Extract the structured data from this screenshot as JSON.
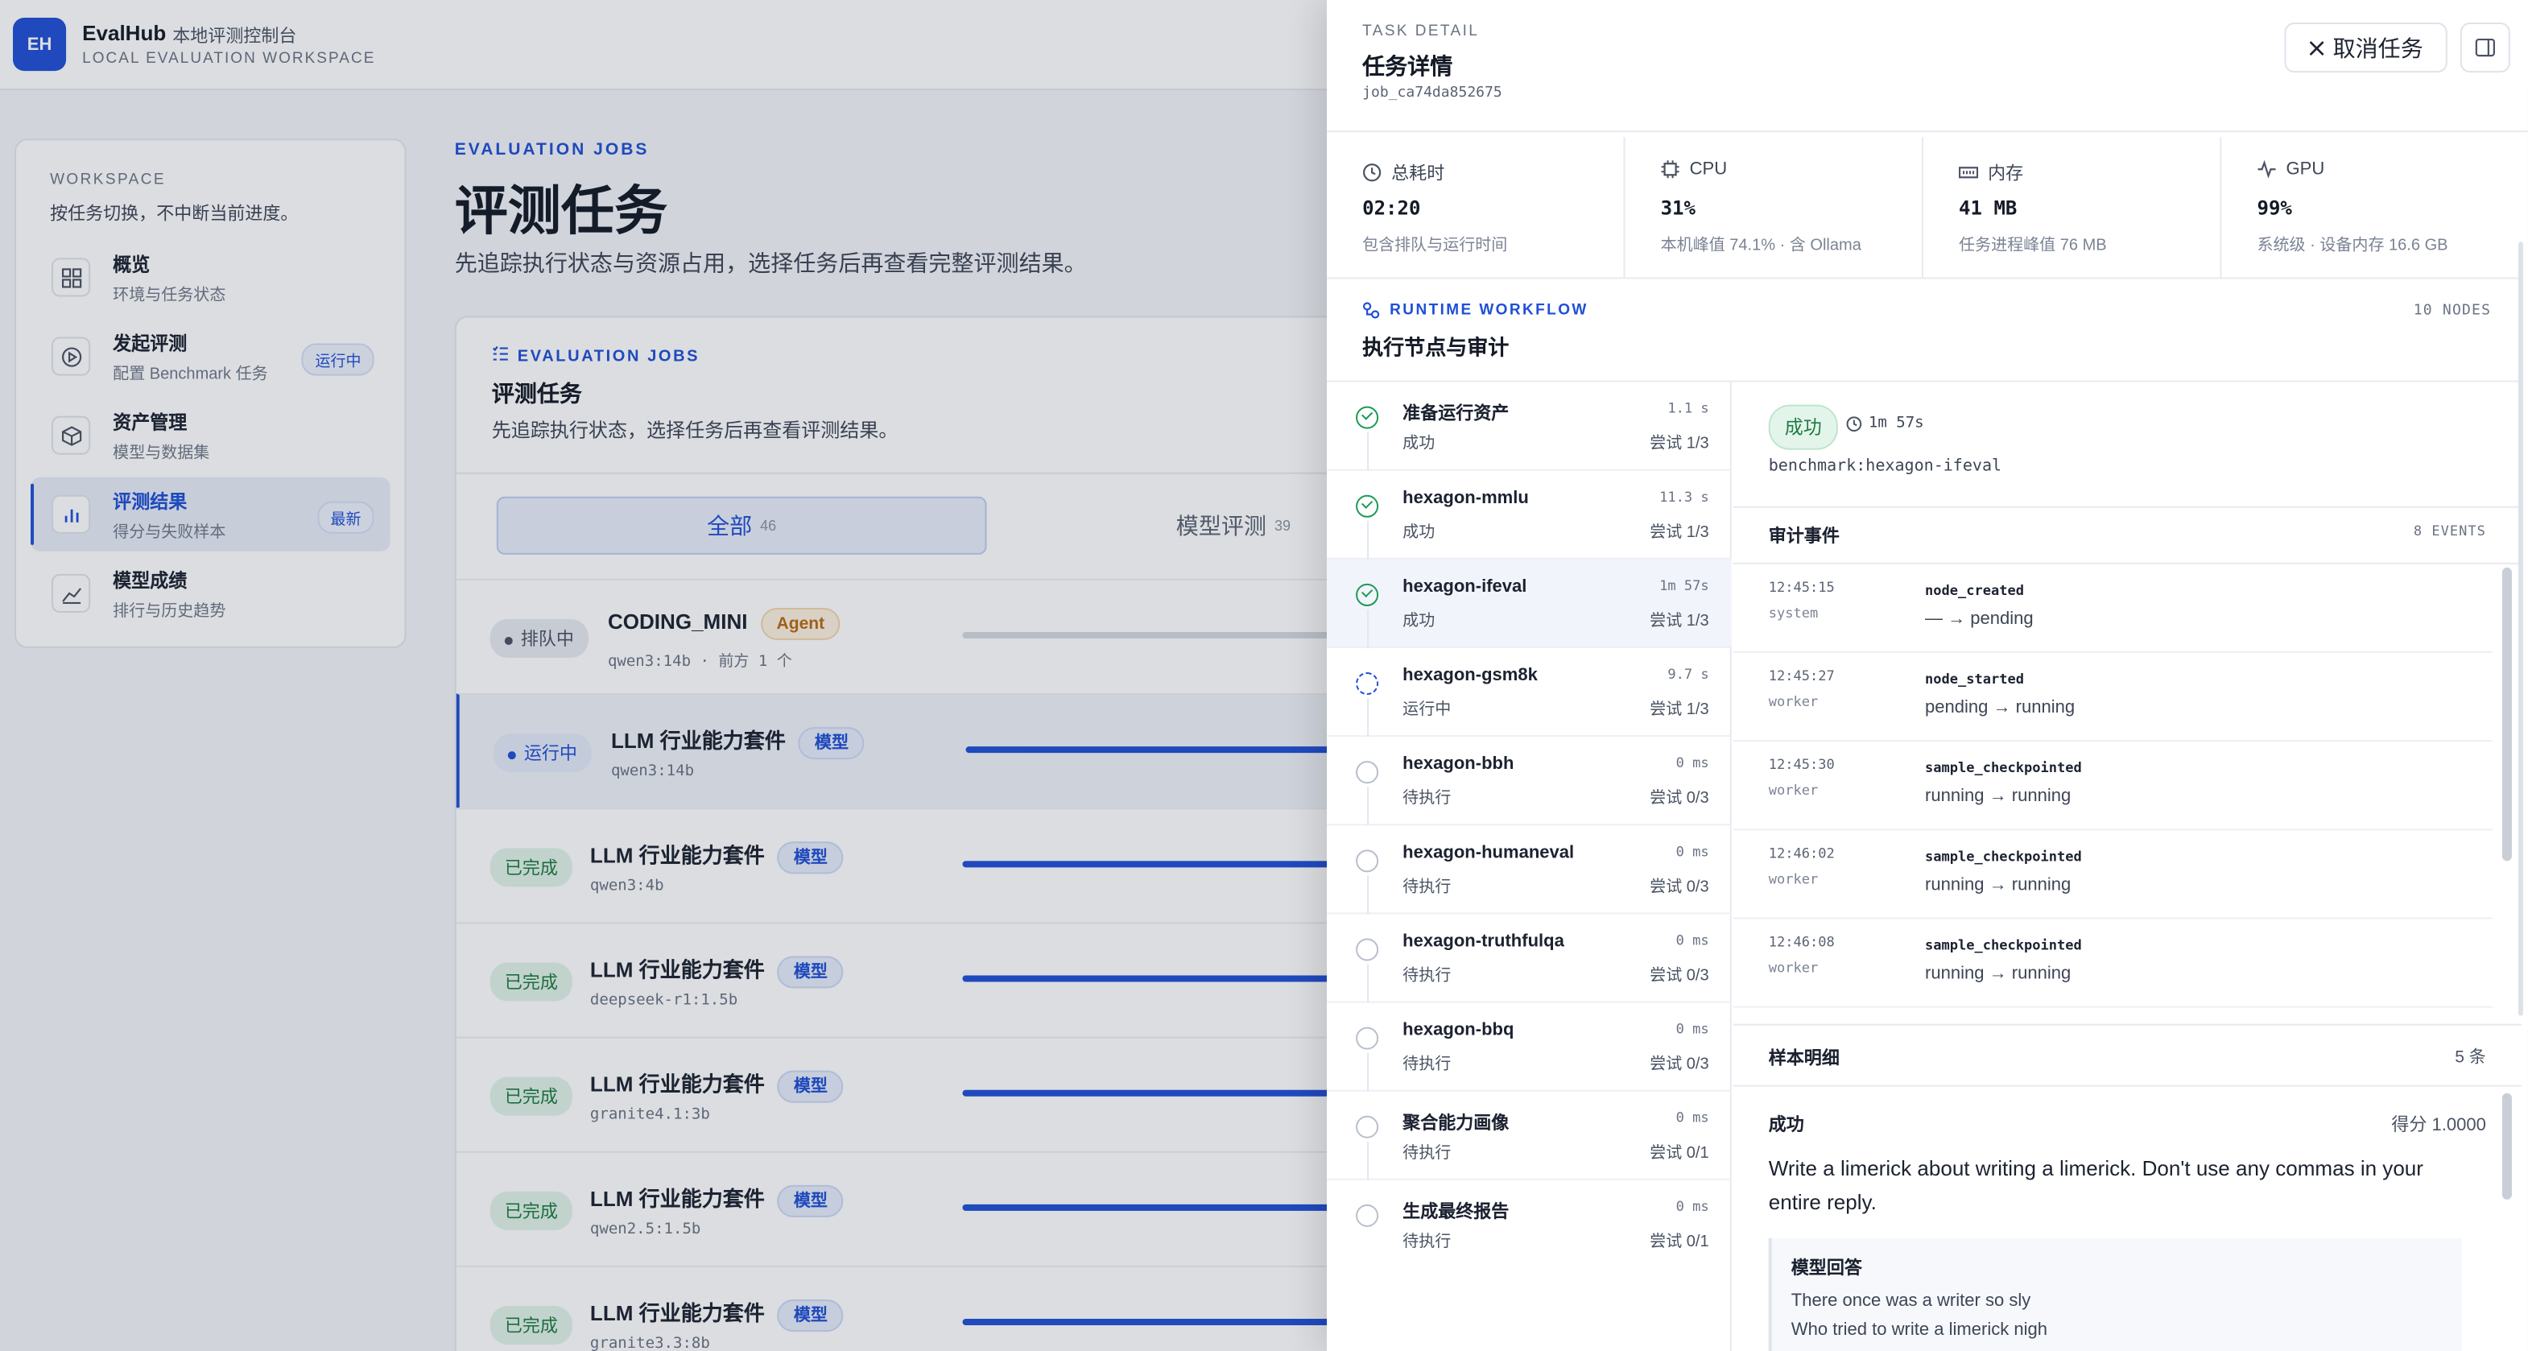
{
  "brand": {
    "logo": "EH",
    "name": "EvalHub",
    "subtitle": "本地评测控制台",
    "en": "LOCAL EVALUATION WORKSPACE"
  },
  "sidebar": {
    "label": "WORKSPACE",
    "desc": "按任务切换，不中断当前进度。",
    "items": [
      {
        "title": "概览",
        "sub": "环境与任务状态",
        "badge": "",
        "icon": "grid-icon"
      },
      {
        "title": "发起评测",
        "sub": "配置 Benchmark 任务",
        "badge": "运行中",
        "icon": "play-icon"
      },
      {
        "title": "资产管理",
        "sub": "模型与数据集",
        "badge": "",
        "icon": "box-icon"
      },
      {
        "title": "评测结果",
        "sub": "得分与失败样本",
        "badge": "最新",
        "icon": "bar-chart-icon"
      },
      {
        "title": "模型成绩",
        "sub": "排行与历史趋势",
        "badge": "",
        "icon": "trend-icon"
      }
    ]
  },
  "main": {
    "eyebrow": "EVALUATION JOBS",
    "title": "评测任务",
    "desc": "先追踪执行状态与资源占用，选择任务后再查看完整评测结果。"
  },
  "panel": {
    "eyebrow": "EVALUATION JOBS",
    "title": "评测任务",
    "desc": "先追踪执行状态，选择任务后再查看评测结果。",
    "tabs": [
      {
        "label": "全部",
        "count": "46"
      },
      {
        "label": "模型评测",
        "count": "39"
      }
    ],
    "jobs": [
      {
        "status": "排队中",
        "name": "CODING_MINI",
        "tag": "Agent",
        "sub": "qwen3:14b · 前方 1 个",
        "progress": 0.9
      },
      {
        "status": "运行中",
        "name": "LLM 行业能力套件",
        "tag": "模型",
        "sub": "qwen3:14b",
        "progress": 1.0
      },
      {
        "status": "已完成",
        "name": "LLM 行业能力套件",
        "tag": "模型",
        "sub": "qwen3:4b",
        "progress": 1.0
      },
      {
        "status": "已完成",
        "name": "LLM 行业能力套件",
        "tag": "模型",
        "sub": "deepseek-r1:1.5b",
        "progress": 1.0
      },
      {
        "status": "已完成",
        "name": "LLM 行业能力套件",
        "tag": "模型",
        "sub": "granite4.1:3b",
        "progress": 1.0
      },
      {
        "status": "已完成",
        "name": "LLM 行业能力套件",
        "tag": "模型",
        "sub": "qwen2.5:1.5b",
        "progress": 1.0
      },
      {
        "status": "已完成",
        "name": "LLM 行业能力套件",
        "tag": "模型",
        "sub": "granite3.3:8b",
        "progress": 1.0
      }
    ]
  },
  "drawer": {
    "eyebrow": "TASK DETAIL",
    "title": "任务详情",
    "job_id": "job_ca74da852675",
    "cancel_label": "取消任务",
    "metrics": [
      {
        "label": "总耗时",
        "value": "02:20",
        "sub": "包含排队与运行时间",
        "icon": "clock-icon"
      },
      {
        "label": "CPU",
        "value": "31%",
        "sub": "本机峰值 74.1% · 含 Ollama",
        "icon": "cpu-icon"
      },
      {
        "label": "内存",
        "value": "41 MB",
        "sub": "任务进程峰值 76 MB",
        "icon": "memory-icon"
      },
      {
        "label": "GPU",
        "value": "99%",
        "sub": "系统级 · 设备内存 16.6 GB",
        "icon": "gpu-icon"
      }
    ],
    "workflow": {
      "eyebrow": "RUNTIME WORKFLOW",
      "title": "执行节点与审计",
      "count": "10 NODES",
      "nodes": [
        {
          "name": "准备运行资产",
          "status": "成功",
          "state": "ok",
          "duration": "1.1 s",
          "tries": "尝试 1/3"
        },
        {
          "name": "hexagon-mmlu",
          "status": "成功",
          "state": "ok",
          "duration": "11.3 s",
          "tries": "尝试 1/3"
        },
        {
          "name": "hexagon-ifeval",
          "status": "成功",
          "state": "ok",
          "duration": "1m 57s",
          "tries": "尝试 1/3"
        },
        {
          "name": "hexagon-gsm8k",
          "status": "运行中",
          "state": "run",
          "duration": "9.7 s",
          "tries": "尝试 1/3"
        },
        {
          "name": "hexagon-bbh",
          "status": "待执行",
          "state": "wait",
          "duration": "0 ms",
          "tries": "尝试 0/3"
        },
        {
          "name": "hexagon-humaneval",
          "status": "待执行",
          "state": "wait",
          "duration": "0 ms",
          "tries": "尝试 0/3"
        },
        {
          "name": "hexagon-truthfulqa",
          "status": "待执行",
          "state": "wait",
          "duration": "0 ms",
          "tries": "尝试 0/3"
        },
        {
          "name": "hexagon-bbq",
          "status": "待执行",
          "state": "wait",
          "duration": "0 ms",
          "tries": "尝试 0/3"
        },
        {
          "name": "聚合能力画像",
          "status": "待执行",
          "state": "wait",
          "duration": "0 ms",
          "tries": "尝试 0/1"
        },
        {
          "name": "生成最终报告",
          "status": "待执行",
          "state": "wait",
          "duration": "0 ms",
          "tries": "尝试 0/1"
        }
      ]
    },
    "detail": {
      "badge": "成功",
      "duration": "1m 57s",
      "benchmark": "benchmark:hexagon-ifeval",
      "events_title": "审计事件",
      "events_count": "8 EVENTS",
      "events": [
        {
          "time": "12:45:15",
          "who": "system",
          "name": "node_created",
          "transition": "— → pending"
        },
        {
          "time": "12:45:27",
          "who": "worker",
          "name": "node_started",
          "transition": "pending → running"
        },
        {
          "time": "12:45:30",
          "who": "worker",
          "name": "sample_checkpointed",
          "transition": "running → running"
        },
        {
          "time": "12:46:02",
          "who": "worker",
          "name": "sample_checkpointed",
          "transition": "running → running"
        },
        {
          "time": "12:46:08",
          "who": "worker",
          "name": "sample_checkpointed",
          "transition": "running → running"
        }
      ],
      "samples_title": "样本明细",
      "samples_count": "5 条",
      "sample": {
        "status": "成功",
        "score": "得分 1.0000",
        "question": "Write a limerick about writing a limerick. Don't use any commas in your entire reply.",
        "response_title": "模型回答",
        "response_lines": [
          "There once was a writer so sly",
          "Who tried to write a limerick nigh"
        ]
      }
    }
  }
}
